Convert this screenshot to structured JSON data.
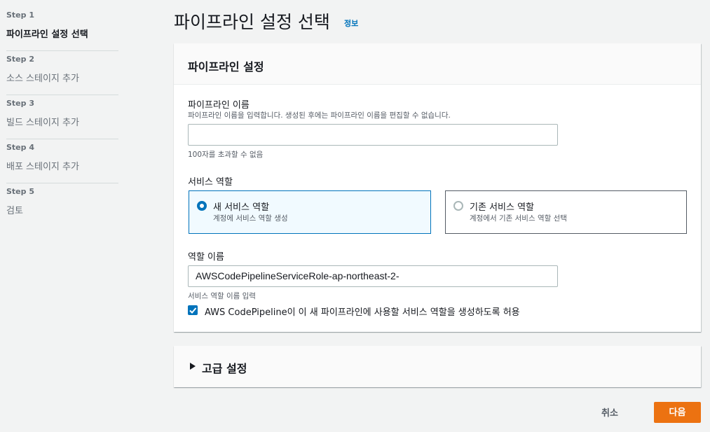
{
  "steps": [
    {
      "num": "Step 1",
      "label": "파이프라인 설정 선택",
      "active": true
    },
    {
      "num": "Step 2",
      "label": "소스 스테이지 추가",
      "active": false
    },
    {
      "num": "Step 3",
      "label": "빌드 스테이지 추가",
      "active": false
    },
    {
      "num": "Step 4",
      "label": "배포 스테이지 추가",
      "active": false
    },
    {
      "num": "Step 5",
      "label": "검토",
      "active": false
    }
  ],
  "page": {
    "title": "파이프라인 설정 선택",
    "info_link": "정보"
  },
  "settings": {
    "header": "파이프라인 설정",
    "pipeline_name": {
      "label": "파이프라인 이름",
      "description": "파이프라인 이름을 입력합니다. 생성된 후에는 파이프라인 이름을 편집할 수 없습니다.",
      "value": "",
      "constraint": "100자를 초과할 수 없음"
    },
    "service_role": {
      "label": "서비스 역할",
      "options": [
        {
          "title": "새 서비스 역할",
          "desc": "계정에 서비스 역할 생성",
          "selected": true
        },
        {
          "title": "기존 서비스 역할",
          "desc": "계정에서 기존 서비스 역할 선택",
          "selected": false
        }
      ]
    },
    "role_name": {
      "label": "역할 이름",
      "value": "AWSCodePipelineServiceRole-ap-northeast-2-",
      "description": "서비스 역할 이름 입력"
    },
    "allow_checkbox": {
      "checked": true,
      "label": "AWS CodePipeline이 이 새 파이프라인에 사용할 서비스 역할을 생성하도록 허용"
    }
  },
  "advanced": {
    "title": "고급 설정"
  },
  "footer": {
    "cancel_label": "취소",
    "next_label": "다음"
  },
  "colors": {
    "accent": "#0073bb",
    "primary_button": "#ec7211"
  }
}
